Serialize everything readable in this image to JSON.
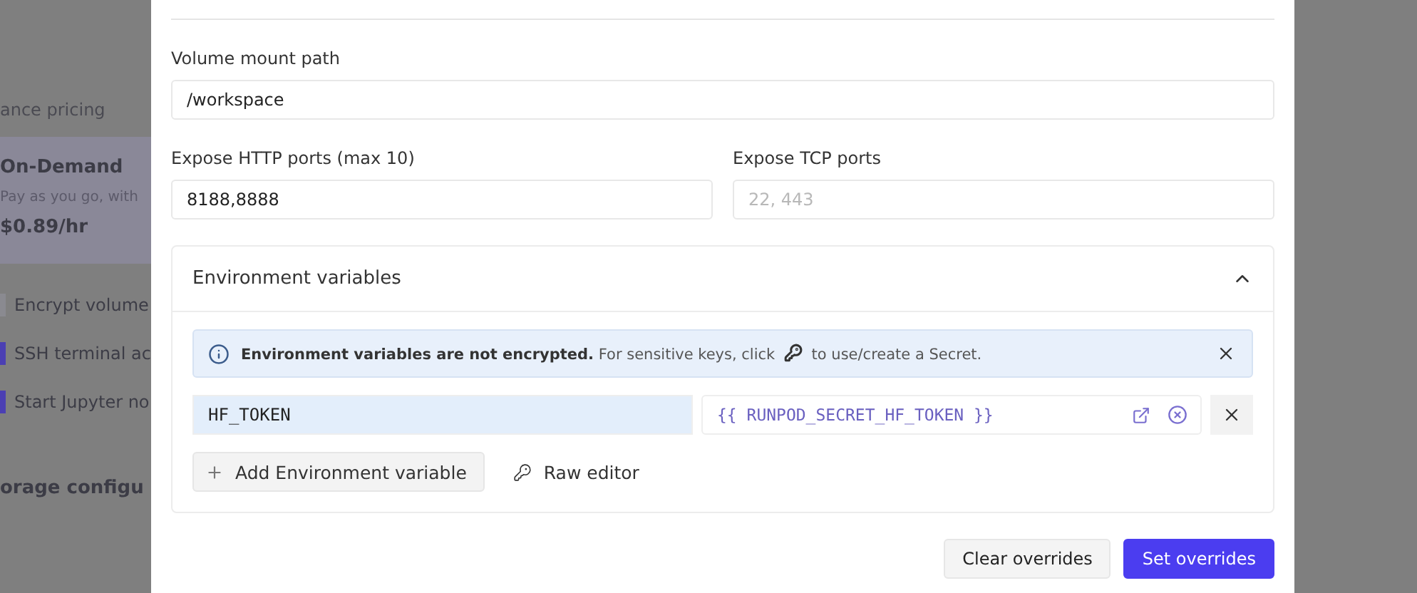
{
  "background": {
    "section_title": "ance pricing",
    "pricing_option": {
      "title": "On-Demand",
      "description": "Pay as you go, with",
      "price": "$0.89/hr"
    },
    "options": [
      {
        "label": "Encrypt volume",
        "checked": false
      },
      {
        "label": "SSH terminal ac",
        "checked": true
      },
      {
        "label": "Start Jupyter no",
        "checked": true
      }
    ],
    "next_section_title": "orage configu"
  },
  "dialog": {
    "volume_mount_path": {
      "label": "Volume mount path",
      "value": "/workspace"
    },
    "http_ports": {
      "label": "Expose HTTP ports (max 10)",
      "value": "8188,8888"
    },
    "tcp_ports": {
      "label": "Expose TCP ports",
      "placeholder": "22, 443"
    },
    "env_section": {
      "title": "Environment variables",
      "expanded": true,
      "notice": {
        "bold": "Environment variables are not encrypted.",
        "before_icon": "For sensitive keys, click",
        "after_icon": "to use/create a Secret."
      },
      "variables": [
        {
          "key": "HF_TOKEN",
          "value": "{{ RUNPOD_SECRET_HF_TOKEN }}",
          "key_selected": true
        }
      ],
      "add_button": "Add Environment variable",
      "raw_editor": "Raw editor"
    },
    "buttons": [
      {
        "label": "Clear overrides",
        "kind": "secondary"
      },
      {
        "label": "Set overrides",
        "kind": "primary"
      }
    ]
  }
}
